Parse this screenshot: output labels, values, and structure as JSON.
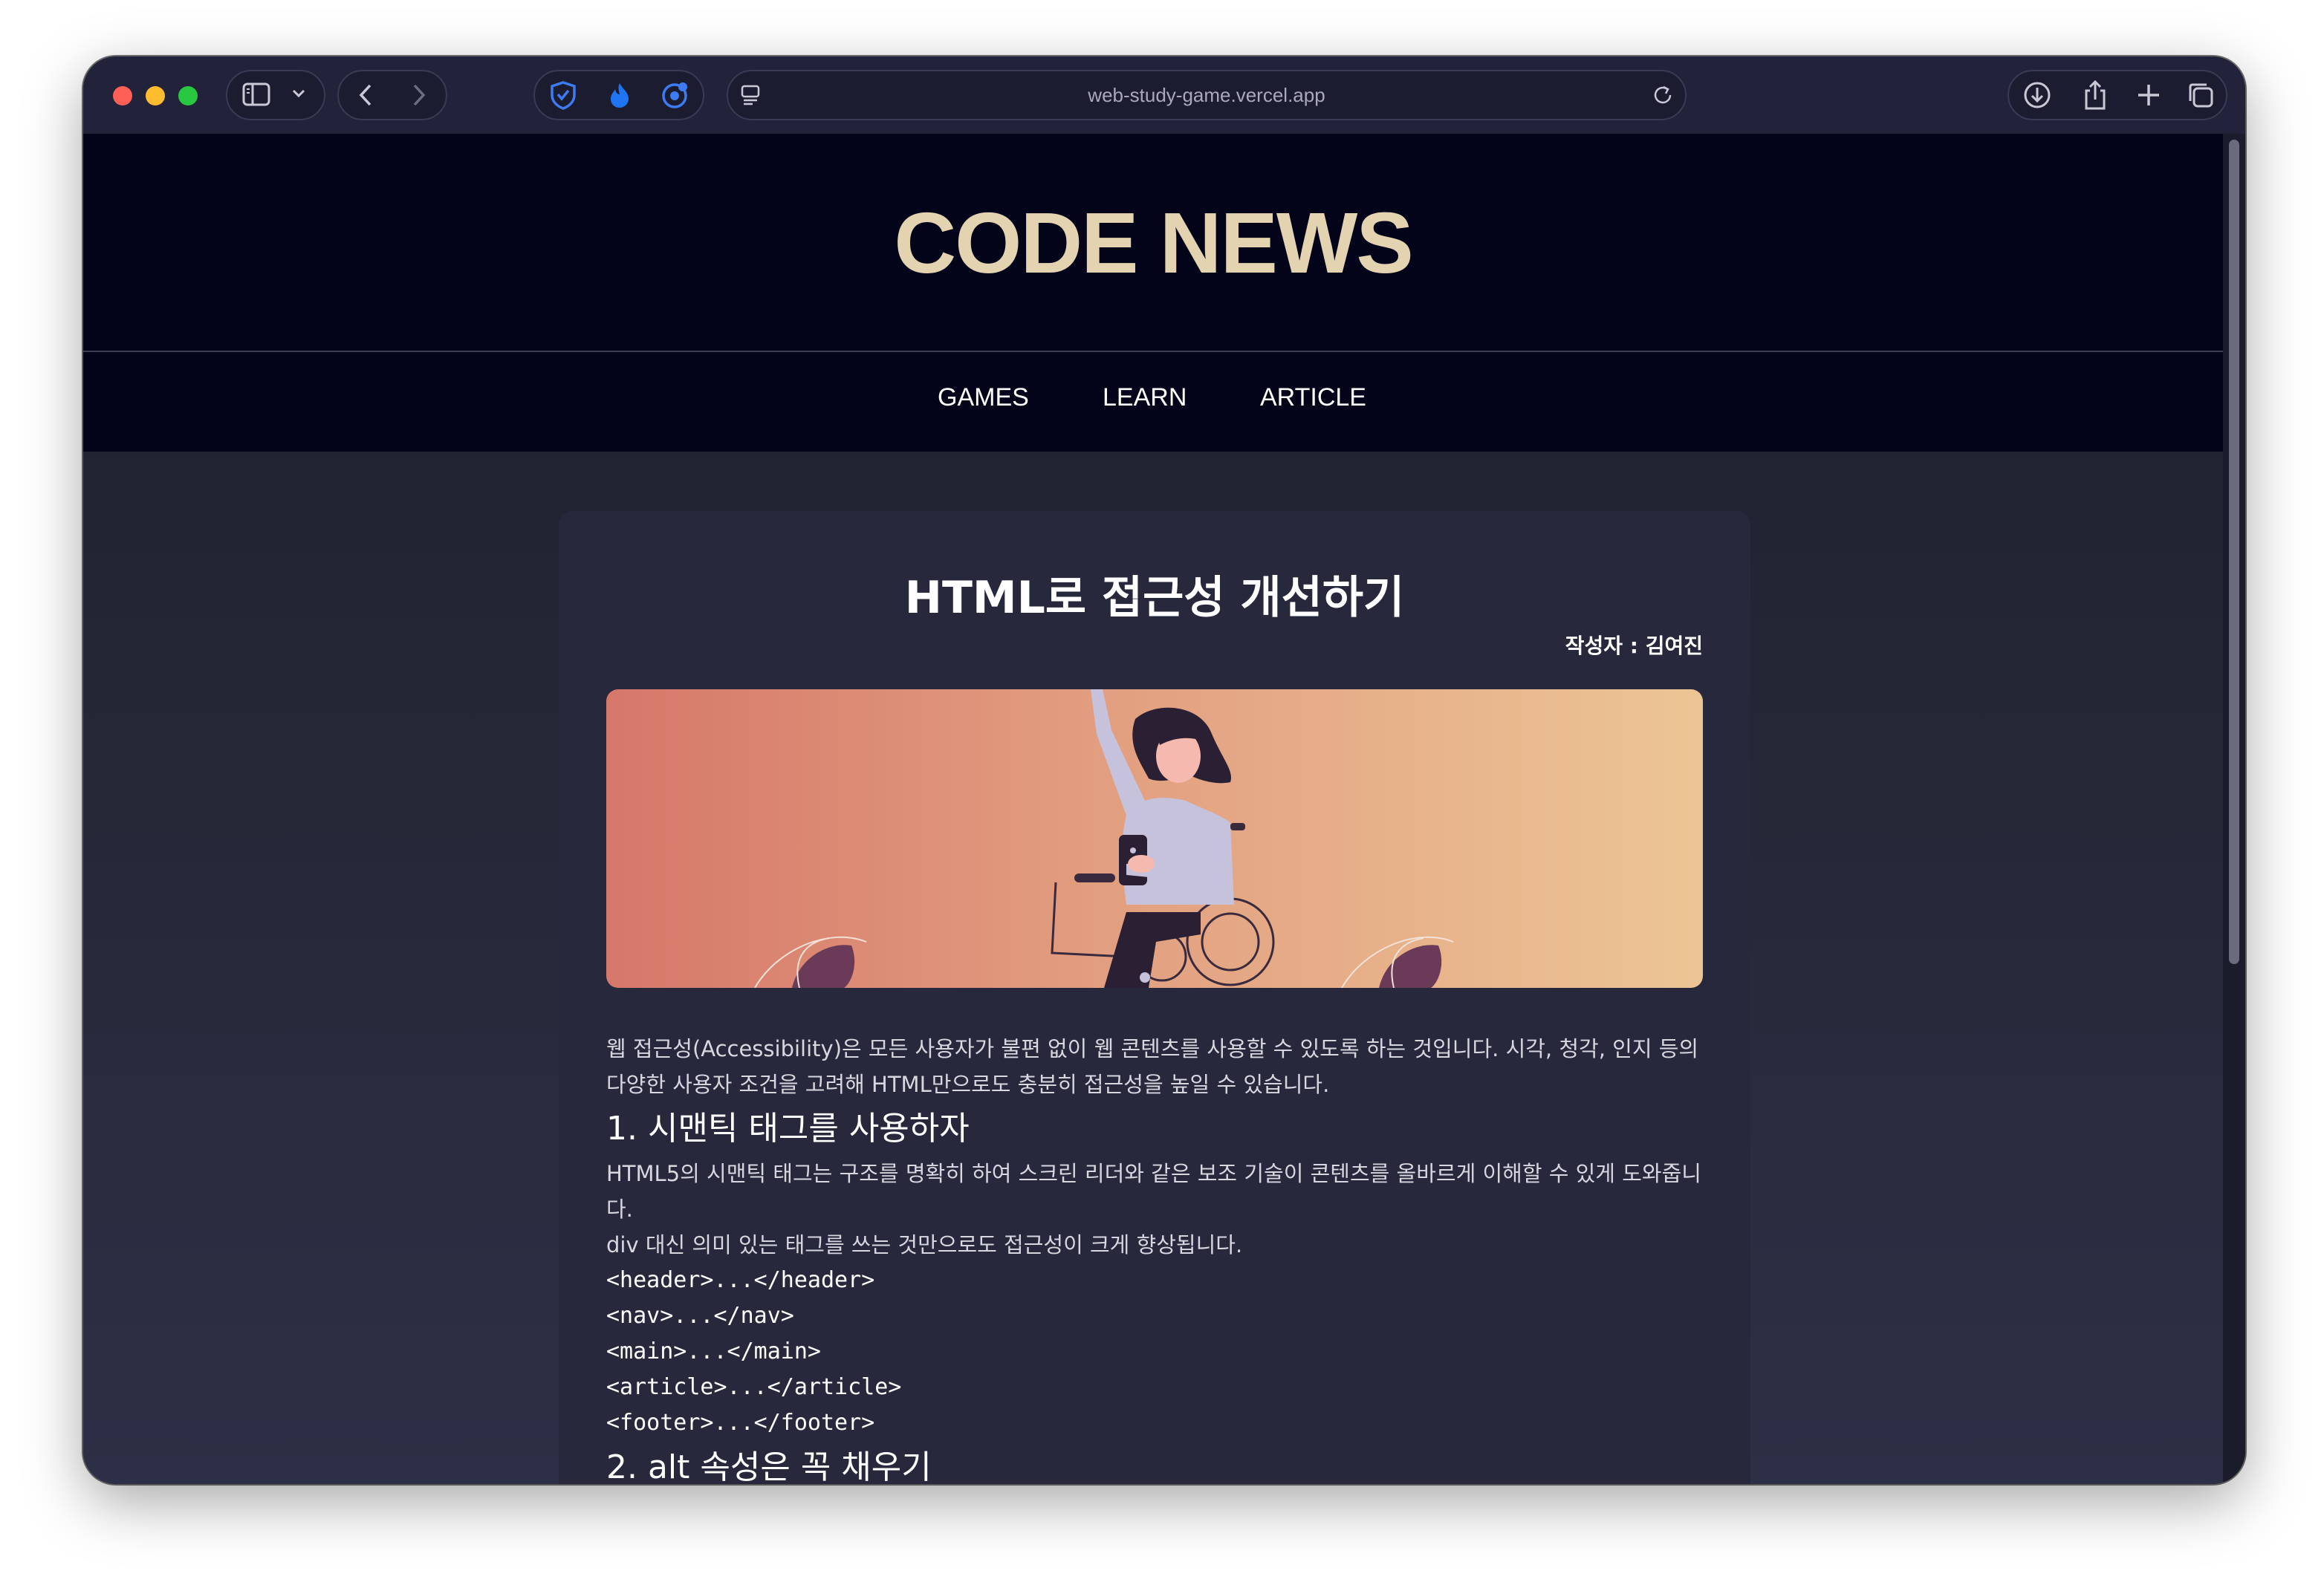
{
  "browser": {
    "url": "web-study-game.vercel.app"
  },
  "site": {
    "title": "CODE NEWS",
    "nav": [
      "GAMES",
      "LEARN",
      "ARTICLE"
    ]
  },
  "article": {
    "title": "HTML로 접근성 개선하기",
    "author": "작성자 : 김여진",
    "intro": "웹 접근성(Accessibility)은 모든 사용자가 불편 없이 웹 콘텐츠를 사용할 수 있도록 하는 것입니다. 시각, 청각, 인지 등의 다양한 사용자 조건을 고려해 HTML만으로도 충분히 접근성을 높일 수 있습니다.",
    "section1_heading": "1. 시맨틱 태그를 사용하자",
    "section1_p1": "HTML5의 시맨틱 태그는 구조를 명확히 하여 스크린 리더와 같은 보조 기술이 콘텐츠를 올바르게 이해할 수 있게 도와줍니다.",
    "section1_p2": "div 대신 의미 있는 태그를 쓰는 것만으로도 접근성이 크게 향상됩니다.",
    "code_lines": [
      "<header>...</header>",
      "<nav>...</nav>",
      "<main>...</main>",
      "<article>...</article>",
      "<footer>...</footer>"
    ],
    "section2_heading": "2. alt 속성은 꼭 채우기"
  }
}
